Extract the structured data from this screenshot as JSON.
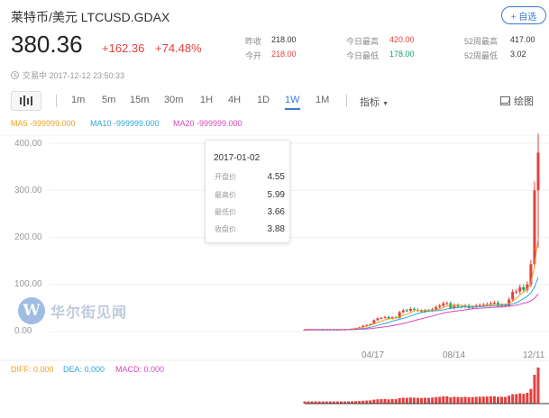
{
  "header": {
    "title": "莱特币/美元  LTCUSD.GDAX",
    "add_button": "+ 自选",
    "price": "380.36",
    "change": "+162.36",
    "change_pct": "+74.48%",
    "timestamp": "交易中 2017-12-12 23:50:33"
  },
  "stats": {
    "prev_close_label": "昨收",
    "prev_close": "218.00",
    "open_label": "今开",
    "open": "218.00",
    "high_label": "今日最高",
    "high": "420.00",
    "low_label": "今日最低",
    "low": "178.00",
    "w52_high_label": "52周最高",
    "w52_high": "417.00",
    "w52_low_label": "52周最低",
    "w52_low": "3.02"
  },
  "toolbar": {
    "timeframes": [
      "1m",
      "5m",
      "15m",
      "30m",
      "1H",
      "4H",
      "1D",
      "1W",
      "1M"
    ],
    "active": "1W",
    "indicators_label": "指标",
    "draw_label": "绘图"
  },
  "ma_legend": {
    "ma5": "MA5  -999999.000",
    "ma10": "MA10  -999999.000",
    "ma20": "MA20  -999999.000"
  },
  "tooltip": {
    "date": "2017-01-02",
    "open_label": "开盘价",
    "open": "4.55",
    "high_label": "最高价",
    "high": "5.99",
    "low_label": "最低价",
    "low": "3.66",
    "close_label": "收盘价",
    "close": "3.88"
  },
  "watermark": "华尔街见闻",
  "macd_legend": {
    "diff": "DIFF: 0.000",
    "dea": "DEA: 0.000",
    "macd": "MACD: 0.000"
  },
  "colors": {
    "up": "#e2413f",
    "down": "#1aa260",
    "accent": "#3a78d8",
    "ma5": "#f0a020",
    "ma10": "#2aa7d8",
    "ma20": "#d848b8"
  },
  "chart_data": {
    "type": "candlestick",
    "yticks": [
      "400.00",
      "300.00",
      "200.00",
      "100.00",
      "0.00"
    ],
    "ylim": [
      0,
      420
    ],
    "xticks": [
      "04/17",
      "08/14",
      "12/11"
    ],
    "series": [
      {
        "name": "close",
        "values": [
          3.9,
          4.0,
          4.1,
          4.2,
          4.0,
          3.9,
          4.1,
          4.3,
          4.0,
          3.9,
          4.2,
          4.3,
          4.8,
          6.2,
          7.5,
          9,
          12.5,
          14,
          16,
          24,
          28,
          29,
          31,
          27,
          30,
          29,
          41,
          45,
          44,
          48,
          46,
          44,
          42,
          45,
          44,
          47,
          52,
          55,
          60,
          60,
          50,
          56,
          53,
          52,
          55,
          50,
          52,
          55,
          56,
          57,
          58,
          60,
          61,
          54,
          56,
          55,
          68,
          84,
          85,
          94,
          88,
          100,
          143,
          300,
          380
        ]
      },
      {
        "name": "ma5",
        "values": [
          4,
          4,
          4,
          4,
          4,
          4,
          4,
          4,
          4,
          4,
          4,
          4,
          4.3,
          5,
          6,
          7,
          9,
          11,
          13,
          16,
          19,
          22,
          25,
          27,
          28,
          29,
          31,
          34,
          37,
          40,
          44,
          45,
          44,
          45,
          45,
          45,
          46,
          48,
          51,
          54,
          55,
          55,
          56,
          56,
          54,
          53,
          52,
          52,
          53,
          54,
          56,
          57,
          58,
          58,
          58,
          57,
          60,
          64,
          70,
          78,
          84,
          90,
          103,
          138,
          200
        ]
      },
      {
        "name": "ma10",
        "values": [
          4,
          4,
          4,
          4,
          4,
          4,
          4,
          4,
          4,
          4,
          4,
          4,
          4.2,
          4.5,
          5,
          5.5,
          6.5,
          7.5,
          9,
          11,
          13,
          15,
          17,
          19,
          22,
          24,
          26,
          28,
          30,
          33,
          36,
          38,
          40,
          42,
          43,
          44,
          44,
          45,
          46,
          48,
          49,
          50,
          51,
          52,
          53,
          53,
          53,
          53,
          53,
          53,
          54,
          54,
          55,
          55,
          56,
          56,
          57,
          59,
          61,
          65,
          70,
          75,
          82,
          95,
          115
        ]
      },
      {
        "name": "ma20",
        "values": [
          4,
          4,
          4,
          4,
          4,
          4,
          4,
          4,
          4,
          4,
          4,
          4,
          4.1,
          4.2,
          4.4,
          4.7,
          5,
          5.5,
          6.2,
          7,
          8,
          9,
          10,
          11,
          12.5,
          14,
          15.5,
          17,
          19,
          21,
          23,
          25,
          27,
          29,
          31,
          33,
          35,
          37,
          39,
          41,
          42,
          43,
          44,
          45,
          46,
          47,
          48,
          49,
          49.5,
          50,
          50.5,
          51,
          51.5,
          52,
          52.5,
          53,
          54,
          55,
          56,
          58,
          60,
          62,
          65,
          70,
          80
        ]
      }
    ]
  }
}
